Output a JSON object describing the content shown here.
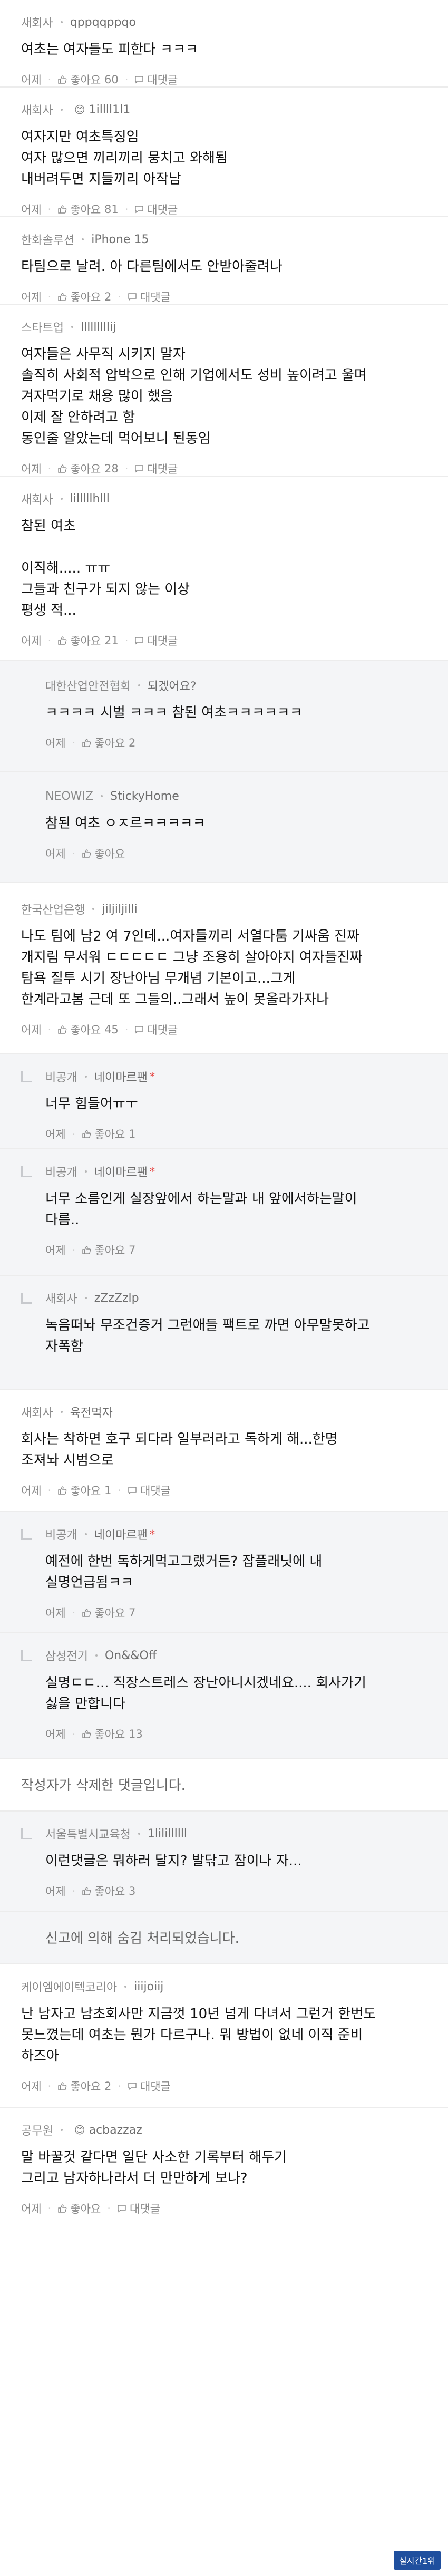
{
  "labels": {
    "time": "어제",
    "like": "좋아요",
    "reply": "대댓글"
  },
  "comments": [
    {
      "company": "새회사",
      "nick": "qppqqppqo",
      "text": "여초는 여자들도 피한다 ㅋㅋㅋ",
      "likes": "60",
      "time": "어제",
      "reply_label": "대댓글"
    },
    {
      "company": "새회사",
      "nick": "1illll1l1",
      "text": "여자지만 여초특징임\n여자 많으면 끼리끼리 뭉치고 와해됨\n내버려두면 지들끼리 아작남",
      "likes": "81",
      "time": "어제",
      "reply_label": "대댓글"
    },
    {
      "company": "한화솔루션",
      "nick": "iPhone 15",
      "text": "타팀으로 날려. 아 다른팀에서도 안받아줄려나",
      "likes": "2",
      "time": "어제",
      "reply_label": "대댓글"
    },
    {
      "company": "스타트업",
      "nick": "lllllllllij",
      "text": "여자들은 사무직 시키지 말자\n솔직히 사회적 압박으로 인해 기업에서도 성비 높이려고 울며\n겨자먹기로 채용 많이 했음\n이제 잘 안하려고 함\n동인줄 알았는데 먹어보니 된동임",
      "likes": "28",
      "time": "어제",
      "reply_label": "대댓글"
    },
    {
      "company": "새회사",
      "nick": "lilllllhlll",
      "text": "참된 여초\n\n이직해..... ㅠㅠ\n그들과 친구가 되지 않는 이상\n평생 적...",
      "likes": "21",
      "time": "어제",
      "reply_label": "대댓글"
    },
    {
      "company": "대한산업안전협회",
      "nick": "되겠어요?",
      "text": "ㅋㅋㅋㅋ 시벌 ㅋㅋㅋ 참된 여초ㅋㅋㅋㅋㅋㅋ",
      "likes": "2",
      "time": "어제"
    },
    {
      "company": "NEOWIZ",
      "nick": "StickyHome",
      "text": "참된 여초 ㅇㅈ르ㅋㅋㅋㅋㅋ",
      "likes": "",
      "time": "어제"
    },
    {
      "company": "한국산업은행",
      "nick": "jiljiljilli",
      "text": "나도 팀에 남2 여 7인데...여자들끼리 서열다툼 기싸움 진짜\n개지림 무서워 ㄷㄷㄷㄷㄷ 그냥 조용히 살아야지 여자들진짜\n탐욕 질투 시기 장난아님 무개념 기본이고...그게\n한계라고봄 근데 또 그들의..그래서 높이 못올라가자나",
      "likes": "45",
      "time": "어제",
      "reply_label": "대댓글"
    },
    {
      "company": "비공개",
      "nick": "네이마르팬",
      "text": "너무 힘들어ㅠㅜ",
      "likes": "1",
      "time": "어제"
    },
    {
      "company": "비공개",
      "nick": "네이마르팬",
      "text": "너무 소름인게 실장앞에서 하는말과 내 앞에서하는말이\n다름..",
      "likes": "7",
      "time": "어제"
    },
    {
      "company": "새회사",
      "nick": "zZzZzlp",
      "text": "녹음떠놔 무조건증거 그런애들 팩트로 까면 아무말못하고\n자폭함",
      "likes": "",
      "time": "어제"
    },
    {
      "company": "새회사",
      "nick": "육전먹자",
      "text": "회사는 착하면 호구 되다라 일부러라고 독하게 해...한명\n조져놔 시범으로",
      "likes": "1",
      "time": "어제",
      "reply_label": "대댓글"
    },
    {
      "company": "비공개",
      "nick": "네이마르팬",
      "text": "예전에 한번 독하게먹고그랬거든? 잡플래닛에 내\n실명언급됨ㅋㅋ",
      "likes": "7",
      "time": "어제"
    },
    {
      "company": "삼성전기",
      "nick": "On&&Off",
      "text": "실명ㄷㄷ... 직장스트레스 장난아니시겠네요.... 회사가기\n싫을 만합니다",
      "likes": "13",
      "time": "어제"
    },
    {
      "company": "서울특별시교육청",
      "nick": "1lilillllll",
      "text": "이런댓글은 뭐하러 달지? 발닦고 잠이나 자...",
      "likes": "3",
      "time": "어제"
    },
    {
      "company": "케이엠에이텍코리아",
      "nick": "iiijoiij",
      "text": "난 남자고 남초회사만 지금껏 10년 넘게 다녀서 그런거 한번도\n못느꼈는데 여초는 뭔가 다르구나. 뭐 방법이 없네 이직 준비\n하즈아",
      "likes": "2",
      "time": "어제",
      "reply_label": "대댓글"
    },
    {
      "company": "공무원",
      "nick": "acbazzaz",
      "text": "말 바꿀것 같다면 일단 사소한 기록부터 해두기\n그리고 남자하나라서 더 만만하게 보나?",
      "likes": "",
      "time": "어제",
      "reply_label": "대댓글"
    }
  ],
  "notices": {
    "deleted": "작성자가 삭제한 댓글입니다.",
    "reported": "신고에 의해 숨김 처리되었습니다."
  },
  "watermark": "실시간1위"
}
